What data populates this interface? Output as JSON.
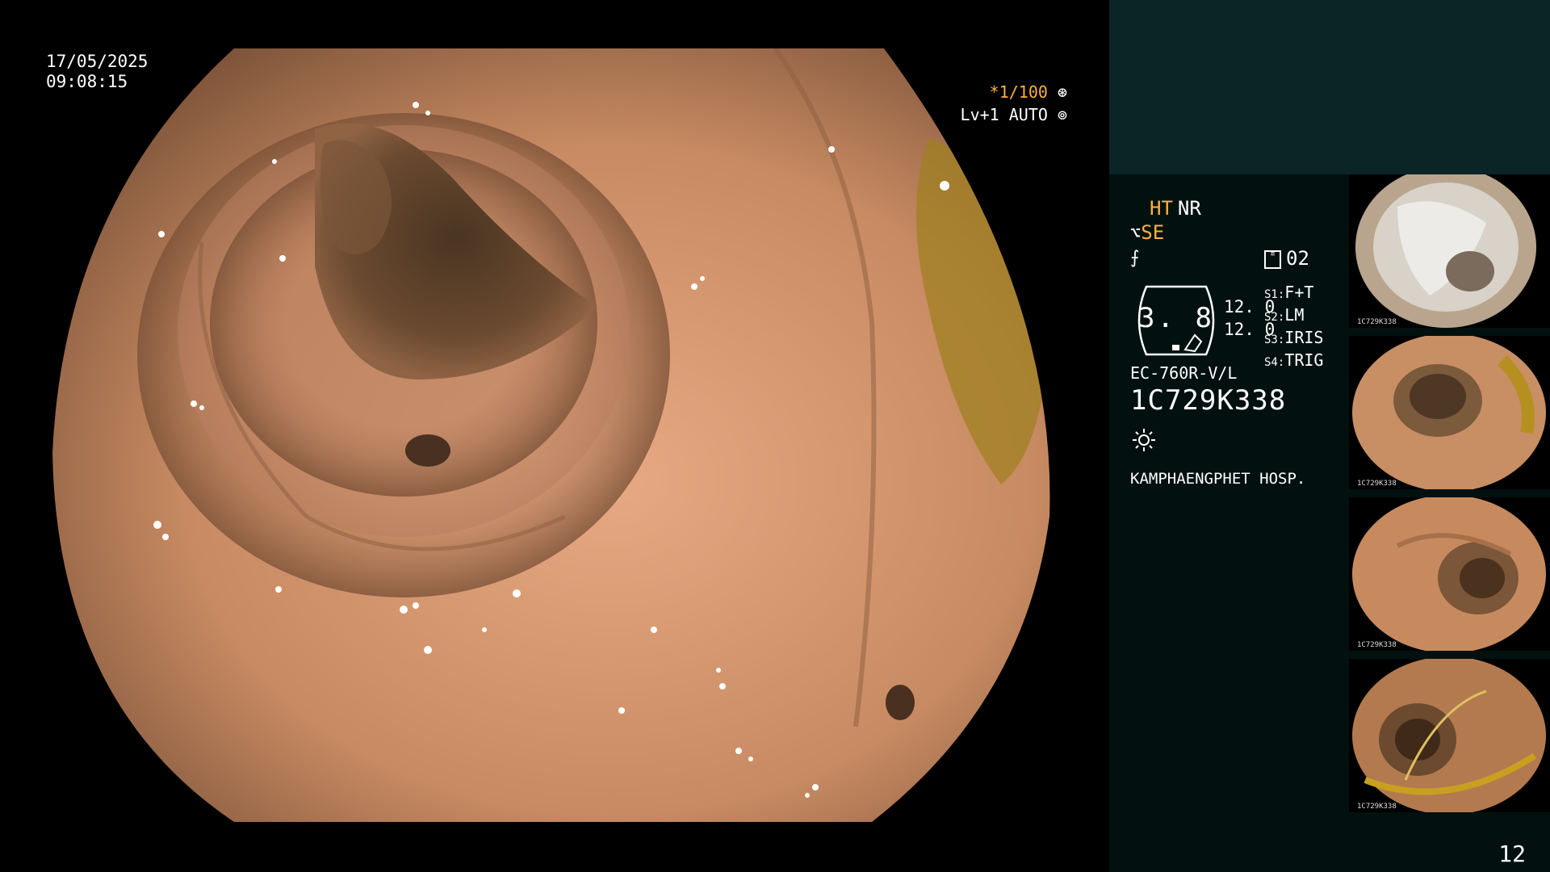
{
  "overlay": {
    "date": "17/05/2025",
    "time": "09:08:15",
    "shutter_mark": "*1/100",
    "shutter_icon": "aperture-icon",
    "level": "Lv+1 AUTO",
    "level_icon": "auto-iris-icon"
  },
  "colors": {
    "accent": "#ffb13b",
    "panel": "#021110",
    "panel_top": "#0b2426"
  },
  "settings": {
    "ht": "HT",
    "nr": "NR",
    "se": "SE",
    "card_count": "02",
    "gauge_value": "3. 8",
    "val1": "12. 0",
    "val2": "12. 0",
    "switches": [
      {
        "key": "S1:",
        "value": "F+T"
      },
      {
        "key": "S2:",
        "value": "LM"
      },
      {
        "key": "S3:",
        "value": "IRIS"
      },
      {
        "key": "S4:",
        "value": "TRIG"
      }
    ],
    "model": "EC-760R-V/L",
    "serial": "1C729K338",
    "lamp_icon": "lamp-sun-icon",
    "hospital": "KAMPHAENGPHET HOSP."
  },
  "thumbnails": [
    {
      "id": "1C729K338"
    },
    {
      "id": "1C729K338"
    },
    {
      "id": "1C729K338"
    },
    {
      "id": "1C729K338"
    }
  ],
  "page_number": "12"
}
